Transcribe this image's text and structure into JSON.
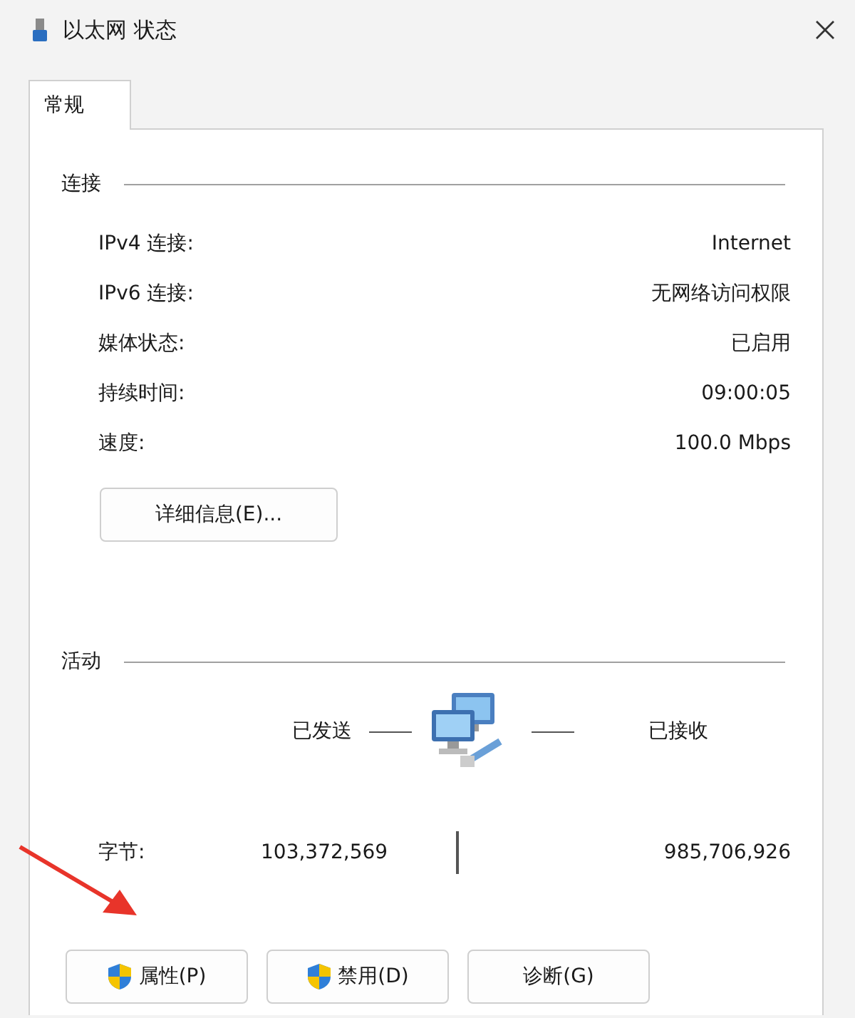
{
  "window": {
    "title": "以太网 状态"
  },
  "tabs": [
    {
      "label": "常规",
      "selected": true
    }
  ],
  "connection": {
    "heading": "连接",
    "rows": [
      {
        "label": "IPv4 连接:",
        "value": "Internet"
      },
      {
        "label": "IPv6 连接:",
        "value": "无网络访问权限"
      },
      {
        "label": "媒体状态:",
        "value": "已启用"
      },
      {
        "label": "持续时间:",
        "value": "09:00:05"
      },
      {
        "label": "速度:",
        "value": "100.0 Mbps"
      }
    ],
    "details_button": "详细信息(E)..."
  },
  "activity": {
    "heading": "活动",
    "sent_label": "已发送",
    "received_label": "已接收",
    "bytes_label": "字节:",
    "bytes_sent": "103,372,569",
    "bytes_received": "985,706,926"
  },
  "buttons": [
    {
      "label": "属性(P)",
      "shield": true
    },
    {
      "label": "禁用(D)",
      "shield": true
    },
    {
      "label": "诊断(G)",
      "shield": false
    }
  ]
}
